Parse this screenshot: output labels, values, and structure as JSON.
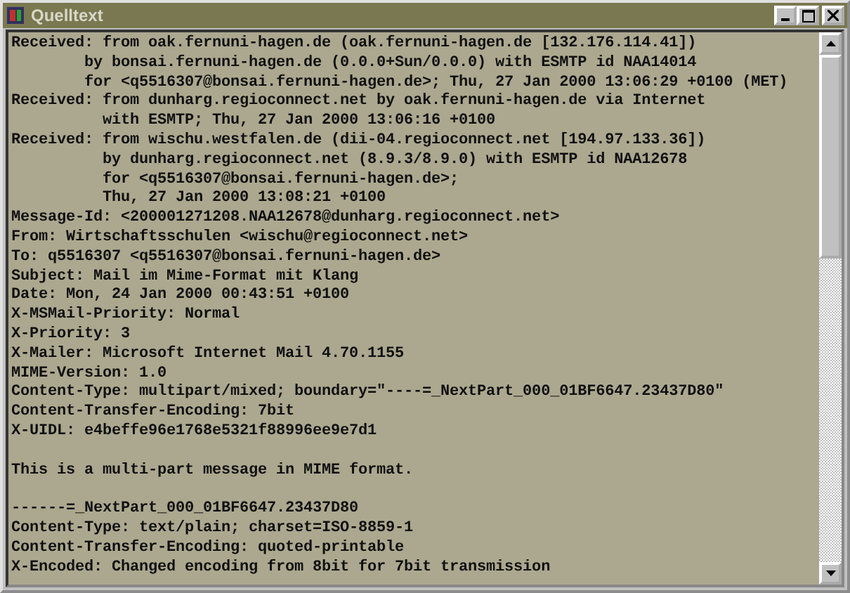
{
  "window": {
    "title": "Quelltext"
  },
  "blocks": [
    [
      "Received: from oak.fernuni-hagen.de (oak.fernuni-hagen.de [132.176.114.41])",
      "        by bonsai.fernuni-hagen.de (0.0.0+Sun/0.0.0) with ESMTP id NAA14014",
      "        for <q5516307@bonsai.fernuni-hagen.de>; Thu, 27 Jan 2000 13:06:29 +0100 (MET)",
      "Received: from dunharg.regioconnect.net by oak.fernuni-hagen.de via Internet",
      "          with ESMTP; Thu, 27 Jan 2000 13:06:16 +0100",
      "Received: from wischu.westfalen.de (dii-04.regioconnect.net [194.97.133.36])",
      "          by dunharg.regioconnect.net (8.9.3/8.9.0) with ESMTP id NAA12678",
      "          for <q5516307@bonsai.fernuni-hagen.de>;",
      "          Thu, 27 Jan 2000 13:08:21 +0100",
      "Message-Id: <200001271208.NAA12678@dunharg.regioconnect.net>",
      "From: Wirtschaftsschulen <wischu@regioconnect.net>",
      "To: q5516307 <q5516307@bonsai.fernuni-hagen.de>",
      "Subject: Mail im Mime-Format mit Klang",
      "Date: Mon, 24 Jan 2000 00:43:51 +0100",
      "X-MSMail-Priority: Normal",
      "X-Priority: 3",
      "X-Mailer: Microsoft Internet Mail 4.70.1155",
      "MIME-Version: 1.0",
      "Content-Type: multipart/mixed; boundary=\"----=_NextPart_000_01BF6647.23437D80\"",
      "Content-Transfer-Encoding: 7bit",
      "X-UIDL: e4beffe96e1768e5321f88996ee9e7d1"
    ],
    [
      "This is a multi-part message in MIME format."
    ],
    [
      "------=_NextPart_000_01BF6647.23437D80",
      "Content-Type: text/plain; charset=ISO-8859-1",
      "Content-Transfer-Encoding: quoted-printable",
      "X-Encoded: Changed encoding from 8bit for 7bit transmission"
    ]
  ]
}
